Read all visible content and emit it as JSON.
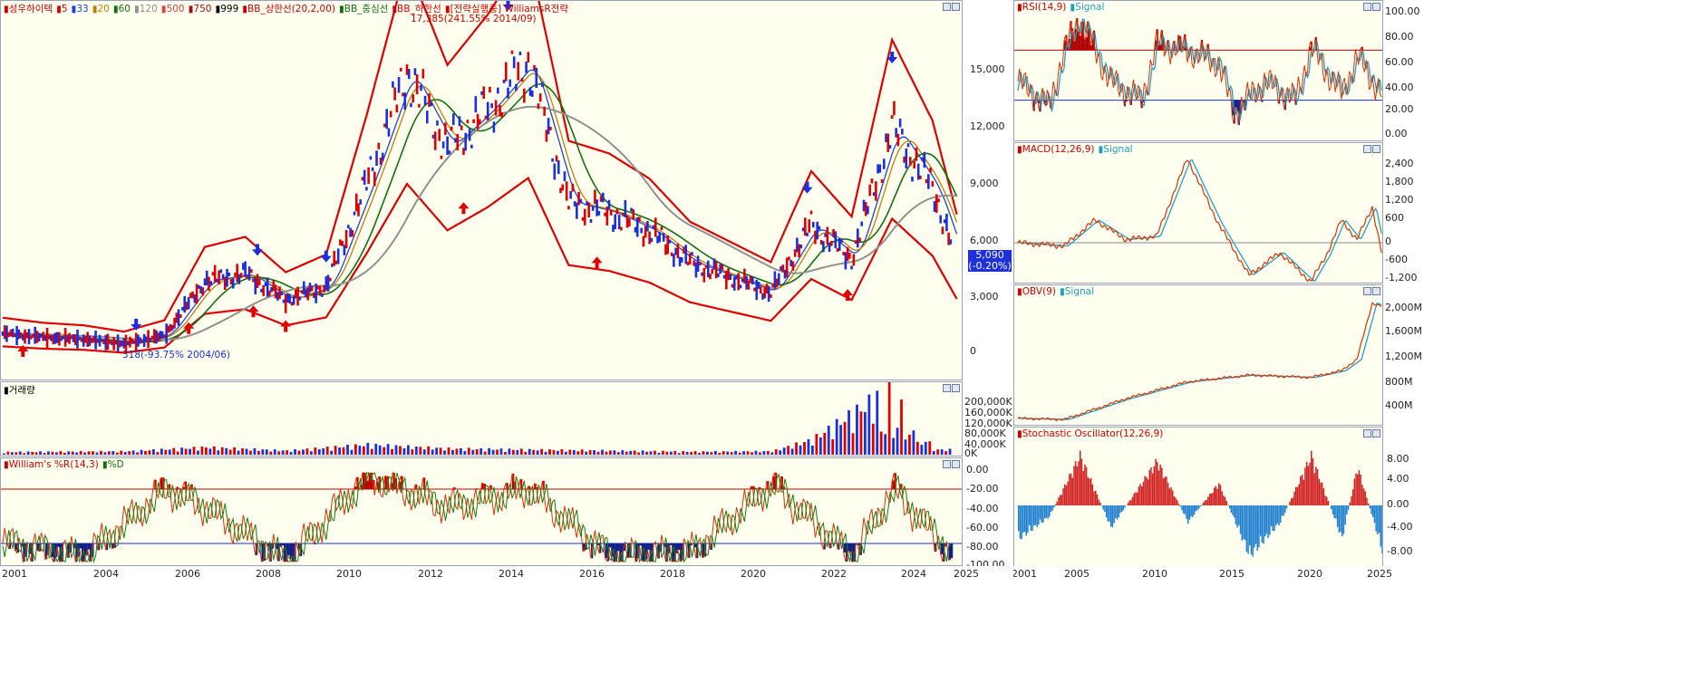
{
  "main_panel": {
    "legend": [
      {
        "text": "성우하이텍",
        "color": "#d00000"
      },
      {
        "text": "5",
        "color": "#e00000"
      },
      {
        "text": "33",
        "color": "#2040e0"
      },
      {
        "text": "20",
        "color": "#c08000"
      },
      {
        "text": "60",
        "color": "#107010"
      },
      {
        "text": "120",
        "color": "#909090"
      },
      {
        "text": "500",
        "color": "#e04040"
      },
      {
        "text": "750",
        "color": "#a01010"
      },
      {
        "text": "999",
        "color": "#000000"
      },
      {
        "text": "BB_상한선(20,2,00)",
        "color": "#d00000"
      },
      {
        "text": "BB_중심선",
        "color": "#107010"
      },
      {
        "text": "BB_하한선",
        "color": "#d00000"
      },
      {
        "text": "[전략실행중] WilliamsR전략",
        "color": "#d00000"
      }
    ],
    "high_annotation": "17,385(241.55% 2014/09)",
    "low_annotation": "318(-93.75% 2004/06)",
    "y_ticks": [
      "15,000",
      "12,000",
      "9,000",
      "6,000",
      "3,000",
      "0"
    ],
    "current_price": "5,090",
    "current_change": "(-0.20%)"
  },
  "volume_panel": {
    "legend": [
      {
        "text": "거래량",
        "color": "#000000"
      }
    ],
    "y_ticks": [
      "200,000K",
      "160,000K",
      "120,000K",
      "80,000K",
      "40,000K",
      "0K"
    ]
  },
  "williams_panel": {
    "legend": [
      {
        "text": "William's %R(14,3)",
        "color": "#d00000"
      },
      {
        "text": "%D",
        "color": "#107010"
      }
    ],
    "y_ticks": [
      "0.00",
      "-20.00",
      "-40.00",
      "-60.00",
      "-80.00",
      "-100.00"
    ]
  },
  "x_axis_left": [
    "2001",
    "2004",
    "2006",
    "2008",
    "2010",
    "2012",
    "2014",
    "2016",
    "2018",
    "2020",
    "2022",
    "2024",
    "2025"
  ],
  "rsi_panel": {
    "legend": [
      {
        "text": "RSI(14,9)",
        "color": "#d00000"
      },
      {
        "text": "Signal",
        "color": "#20a0c0"
      }
    ],
    "y_ticks": [
      "100.00",
      "80.00",
      "60.00",
      "40.00",
      "20.00",
      "0.00"
    ]
  },
  "macd_panel": {
    "legend": [
      {
        "text": "MACD(12,26,9)",
        "color": "#d00000"
      },
      {
        "text": "Signal",
        "color": "#20a0c0"
      }
    ],
    "y_ticks": [
      "2,400",
      "1,800",
      "1,200",
      "600",
      "0",
      "-600",
      "-1,200"
    ]
  },
  "obv_panel": {
    "legend": [
      {
        "text": "OBV(9)",
        "color": "#d00000"
      },
      {
        "text": "Signal",
        "color": "#20a0c0"
      }
    ],
    "y_ticks": [
      "2,000M",
      "1,600M",
      "1,200M",
      "800M",
      "400M"
    ]
  },
  "stoch_panel": {
    "legend": [
      {
        "text": "Stochastic Oscillator(12,26,9)",
        "color": "#d00000"
      }
    ],
    "y_ticks": [
      "8.00",
      "4.00",
      "0.00",
      "-4.00",
      "-8.00"
    ]
  },
  "x_axis_right": [
    "2001",
    "2005",
    "2010",
    "2015",
    "2020",
    "2025"
  ],
  "chart_data": [
    {
      "type": "line",
      "title": "성우하이텍",
      "x": [
        2001,
        2002,
        2003,
        2004,
        2005,
        2006,
        2007,
        2008,
        2009,
        2010,
        2011,
        2012,
        2013,
        2014,
        2015,
        2016,
        2017,
        2018,
        2019,
        2020,
        2021,
        2022,
        2023,
        2024,
        2024.6
      ],
      "series": [
        {
          "name": "성우하이텍",
          "values": [
            1000,
            800,
            700,
            450,
            900,
            3800,
            4200,
            2800,
            3500,
            9000,
            15000,
            11000,
            13000,
            15500,
            8000,
            7500,
            6500,
            4800,
            4000,
            3200,
            6800,
            5000,
            12000,
            8800,
            5090
          ]
        }
      ],
      "ylim": [
        -1500,
        17500
      ]
    },
    {
      "type": "bar",
      "title": "거래량",
      "x": [
        2001,
        2004,
        2006,
        2008,
        2010,
        2012,
        2014,
        2016,
        2018,
        2020,
        2021,
        2023,
        2024
      ],
      "values": [
        8000,
        10000,
        22000,
        12000,
        30000,
        18000,
        15000,
        12000,
        9000,
        10000,
        45000,
        200000,
        15000
      ],
      "ylim": [
        0,
        220000
      ]
    },
    {
      "type": "line",
      "title": "William's %R(14,3)",
      "x": [
        2001,
        2003,
        2005,
        2006,
        2008,
        2010,
        2012,
        2014,
        2016,
        2018,
        2020,
        2022,
        2023,
        2024.6
      ],
      "values": [
        -80,
        -95,
        -20,
        -40,
        -100,
        -5,
        -40,
        -20,
        -95,
        -90,
        -15,
        -95,
        -20,
        -100
      ],
      "ylim": [
        -100,
        10
      ]
    },
    {
      "type": "line",
      "title": "RSI(14,9)",
      "x": [
        2001,
        2003,
        2004,
        2005,
        2007,
        2009,
        2010,
        2012,
        2014,
        2015,
        2017,
        2019,
        2020,
        2022,
        2023,
        2024.6
      ],
      "values": [
        45,
        25,
        70,
        95,
        45,
        30,
        75,
        70,
        60,
        20,
        45,
        30,
        72,
        35,
        65,
        35
      ],
      "ylim": [
        0,
        100
      ]
    },
    {
      "type": "line",
      "title": "MACD(12,26,9)",
      "x": [
        2001,
        2004,
        2006,
        2008,
        2010,
        2012,
        2014,
        2016,
        2018,
        2020,
        2021,
        2022,
        2023,
        2024,
        2024.6
      ],
      "values": [
        0,
        -100,
        700,
        100,
        200,
        2600,
        600,
        -1000,
        -300,
        -1200,
        -400,
        700,
        100,
        1100,
        -300
      ],
      "ylim": [
        -1200,
        2900
      ]
    },
    {
      "type": "line",
      "title": "OBV(9)",
      "x": [
        2001,
        2004,
        2008,
        2012,
        2016,
        2020,
        2022,
        2023,
        2024,
        2024.6
      ],
      "values": [
        50,
        30,
        400,
        700,
        820,
        780,
        900,
        1100,
        2100,
        2050
      ],
      "ylim": [
        0,
        2300
      ]
    },
    {
      "type": "bar",
      "title": "Stochastic Oscillator(12,26,9)",
      "x": [
        2001,
        2003,
        2005,
        2007,
        2010,
        2012,
        2014,
        2016,
        2018,
        2020,
        2022,
        2023,
        2024.6
      ],
      "values": [
        -6,
        -2,
        9,
        -4,
        8,
        -3,
        4,
        -9,
        -3,
        9,
        -6,
        7,
        -8
      ],
      "ylim": [
        -10,
        10
      ]
    }
  ]
}
